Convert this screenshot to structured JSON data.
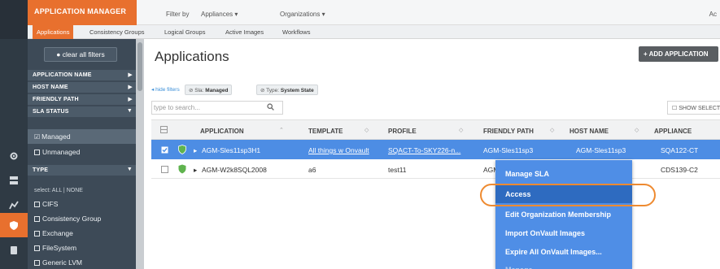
{
  "colors": {
    "brand": "#e8702e",
    "selected_row": "#4d8de4",
    "menu": "#4f8ee6",
    "sidebar": "#3d4a57"
  },
  "rail": {
    "icons": [
      "gear-icon",
      "server-icon",
      "chart-icon",
      "shield-icon",
      "disk-icon"
    ]
  },
  "topbar": {
    "app_title": "APPLICATION MANAGER",
    "filter_by": "Filter by",
    "appliances": "Appliances ▾",
    "organizations": "Organizations ▾",
    "right_text": "Ac"
  },
  "subnav": {
    "tabs": [
      "Applications",
      "Consistency Groups",
      "Logical Groups",
      "Active Images",
      "Workflows"
    ]
  },
  "sidebar": {
    "clear_filters": "clear all filters",
    "headers": [
      "APPLICATION NAME",
      "HOST NAME",
      "FRIENDLY PATH",
      "SLA STATUS"
    ],
    "sla_options": [
      "Managed",
      "Unmanaged"
    ],
    "type_header": "TYPE",
    "select_all_none": "select: ALL | NONE",
    "type_options": [
      "CIFS",
      "Consistency Group",
      "Exchange",
      "FileSystem",
      "Generic LVM"
    ]
  },
  "main": {
    "title": "Applications",
    "add_button": "+ ADD APPLICATION",
    "hide_filters": "◂ hide filters",
    "chip_sla_label": "Sla:",
    "chip_sla_value": "Managed",
    "chip_type_label": "Type:",
    "chip_type_value": "System State",
    "search_placeholder": "type to search...",
    "show_selected": "☐ SHOW SELECT",
    "columns": [
      "APPLICATION",
      "TEMPLATE",
      "PROFILE",
      "FRIENDLY PATH",
      "HOST NAME",
      "APPLIANCE"
    ],
    "rows": [
      {
        "application": "AGM-Sles11sp3H1",
        "template": "All things w Onvault",
        "profile": "SQACT-To-SKY226-n...",
        "friendly_path": "AGM-Sles11sp3",
        "host_name": "AGM-Sles11sp3",
        "appliance": "SQA122-CT"
      },
      {
        "application": "AGM-W2k8SQL2008",
        "template": "a6",
        "profile": "test11",
        "friendly_path": "AGM-",
        "host_name": "",
        "appliance": "CDS139-C2"
      }
    ]
  },
  "context_menu": {
    "items": [
      "Manage SLA",
      "Access",
      "Edit Organization Membership",
      "Import OnVault Images",
      "Expire All OnVault Images...",
      "Manage ..."
    ]
  }
}
